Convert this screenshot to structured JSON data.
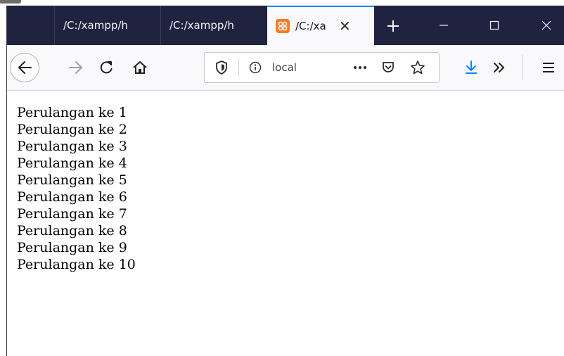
{
  "tabs": [
    {
      "title": "/C:/xampp/h",
      "active": false
    },
    {
      "title": "/C:/xampp/h",
      "active": false
    },
    {
      "title": "/C:/xa",
      "active": true
    }
  ],
  "address_bar": {
    "text": "local"
  },
  "page": {
    "lines": [
      "Perulangan ke 1",
      "Perulangan ke 2",
      "Perulangan ke 3",
      "Perulangan ke 4",
      "Perulangan ke 5",
      "Perulangan ke 6",
      "Perulangan ke 7",
      "Perulangan ke 8",
      "Perulangan ke 9",
      "Perulangan ke 10"
    ]
  },
  "colors": {
    "titlebar": "#202340",
    "toolbar": "#f9f9fb",
    "active_tab_accent": "#0a84ff",
    "download_accent": "#0a84ff",
    "favicon": "#fb7a24"
  },
  "icons": {
    "back": "arrow-left-icon",
    "forward": "arrow-right-icon",
    "reload": "reload-icon",
    "home": "home-icon",
    "tracking": "shield-icon",
    "info": "info-icon",
    "page_actions": "ellipsis-icon",
    "pocket": "pocket-icon",
    "bookmark": "star-icon",
    "downloads": "download-icon",
    "overflow": "chevron-double-right-icon",
    "menu": "hamburger-menu-icon",
    "new_tab": "plus-icon",
    "close_tab": "close-icon",
    "minimize": "minimize-icon",
    "maximize": "maximize-icon",
    "close_window": "close-window-icon",
    "favicon": "xampp-favicon-icon"
  }
}
